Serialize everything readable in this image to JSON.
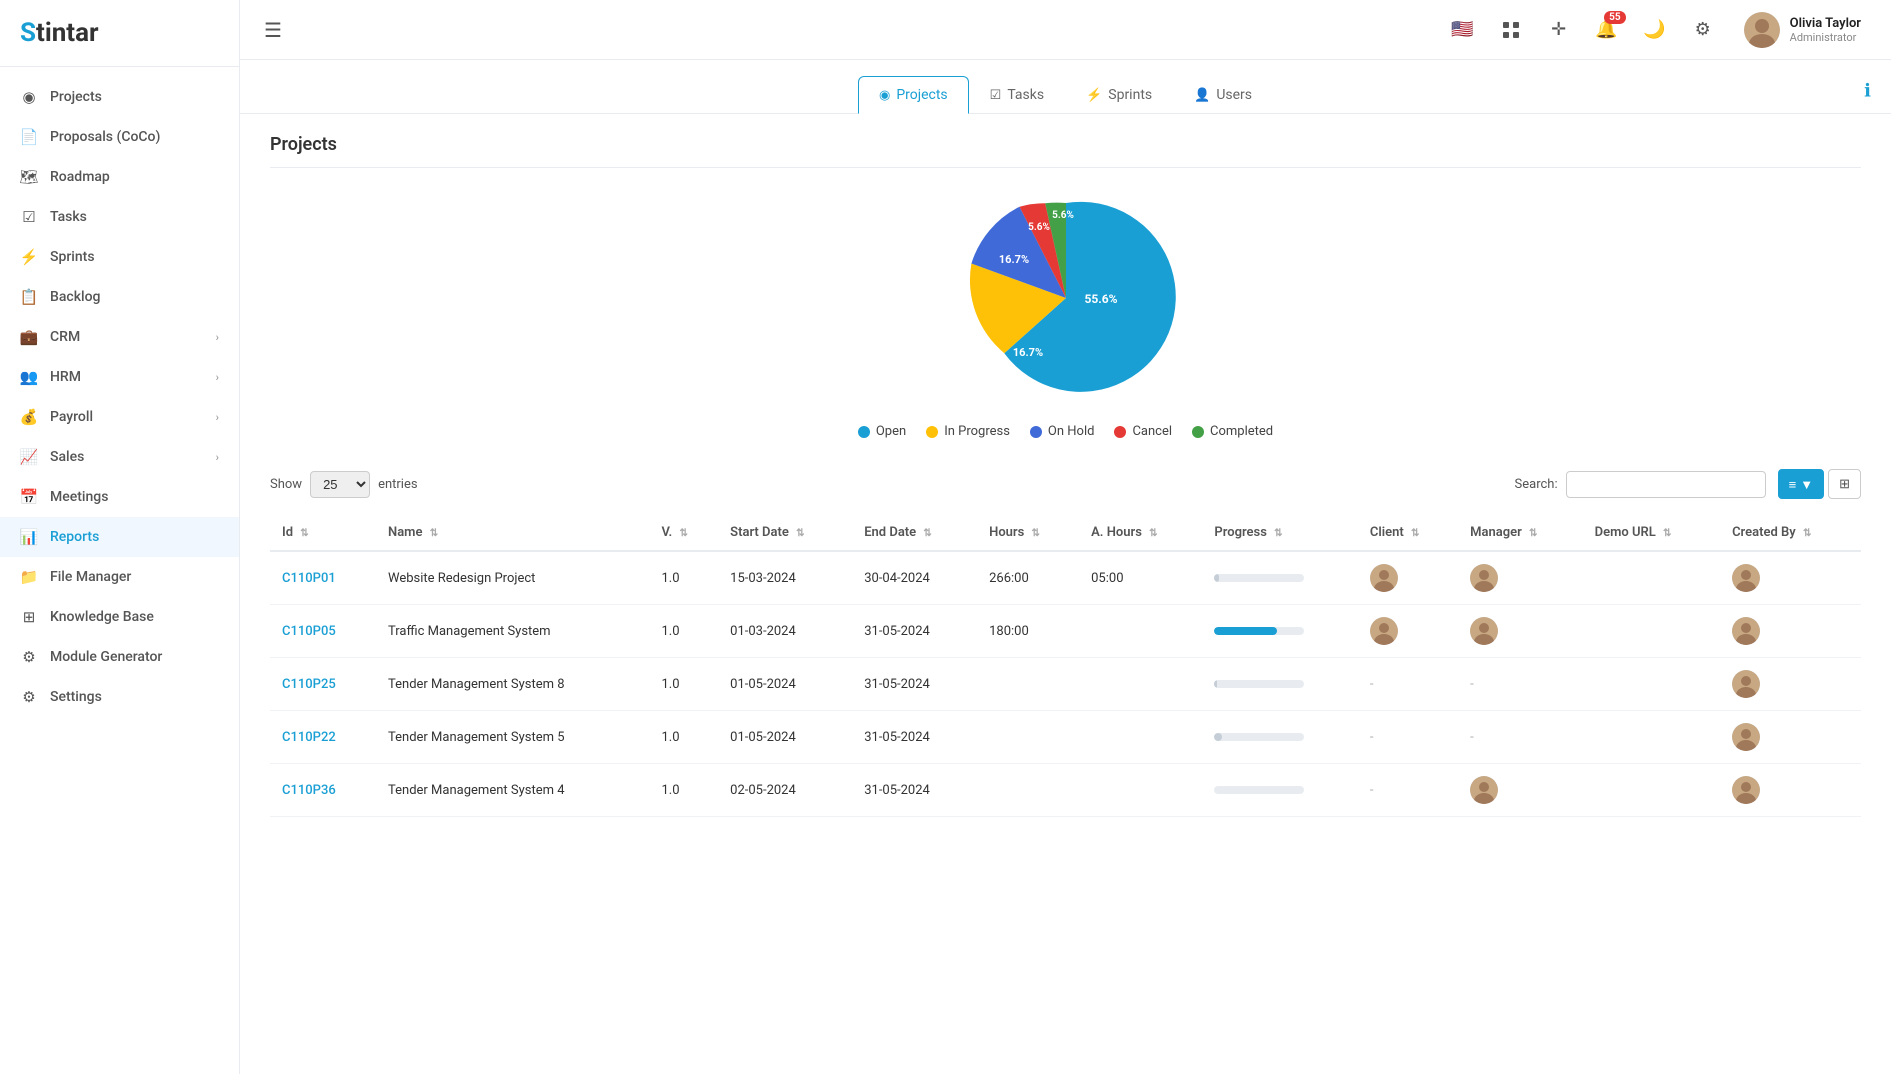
{
  "app": {
    "logo": "Stintar",
    "logo_s": "S"
  },
  "header": {
    "menu_icon": "☰",
    "notification_count": "55",
    "user": {
      "name": "Olivia Taylor",
      "role": "Administrator"
    }
  },
  "sidebar": {
    "items": [
      {
        "id": "projects",
        "label": "Projects",
        "icon": "◉"
      },
      {
        "id": "proposals",
        "label": "Proposals (CoCo)",
        "icon": "📄"
      },
      {
        "id": "roadmap",
        "label": "Roadmap",
        "icon": "🗺"
      },
      {
        "id": "tasks",
        "label": "Tasks",
        "icon": "☑"
      },
      {
        "id": "sprints",
        "label": "Sprints",
        "icon": "⚡"
      },
      {
        "id": "backlog",
        "label": "Backlog",
        "icon": "📋"
      },
      {
        "id": "crm",
        "label": "CRM",
        "icon": "💼",
        "has_children": true
      },
      {
        "id": "hrm",
        "label": "HRM",
        "icon": "👥",
        "has_children": true
      },
      {
        "id": "payroll",
        "label": "Payroll",
        "icon": "💰",
        "has_children": true
      },
      {
        "id": "sales",
        "label": "Sales",
        "icon": "📈",
        "has_children": true
      },
      {
        "id": "meetings",
        "label": "Meetings",
        "icon": "📅"
      },
      {
        "id": "reports",
        "label": "Reports",
        "icon": "📊",
        "active": true
      },
      {
        "id": "filemanager",
        "label": "File Manager",
        "icon": "📁"
      },
      {
        "id": "knowledgebase",
        "label": "Knowledge Base",
        "icon": "⊞"
      },
      {
        "id": "modulegenerator",
        "label": "Module Generator",
        "icon": "⚙"
      },
      {
        "id": "settings",
        "label": "Settings",
        "icon": "⚙"
      }
    ]
  },
  "tabs": [
    {
      "id": "projects",
      "label": "Projects",
      "icon": "◉",
      "active": true
    },
    {
      "id": "tasks",
      "label": "Tasks",
      "icon": "☑"
    },
    {
      "id": "sprints",
      "label": "Sprints",
      "icon": "⚡"
    },
    {
      "id": "users",
      "label": "Users",
      "icon": "👤"
    }
  ],
  "page_title": "Projects",
  "chart": {
    "segments": [
      {
        "label": "Open",
        "value": 55.6,
        "color": "#1a9fd4",
        "text_color": "#fff"
      },
      {
        "label": "In Progress",
        "value": 16.7,
        "color": "#ffc107",
        "text_color": "#fff"
      },
      {
        "label": "On Hold",
        "value": 16.7,
        "color": "#3f6ad8",
        "text_color": "#fff"
      },
      {
        "label": "Cancel",
        "value": 5.6,
        "color": "#e53935",
        "text_color": "#fff"
      },
      {
        "label": "Completed",
        "value": 5.6,
        "color": "#43a047",
        "text_color": "#fff"
      }
    ]
  },
  "table": {
    "show_label": "Show",
    "show_value": "25",
    "entries_label": "entries",
    "search_label": "Search:",
    "search_placeholder": "",
    "columns": [
      {
        "key": "id",
        "label": "Id"
      },
      {
        "key": "name",
        "label": "Name"
      },
      {
        "key": "v",
        "label": "V."
      },
      {
        "key": "start_date",
        "label": "Start Date"
      },
      {
        "key": "end_date",
        "label": "End Date"
      },
      {
        "key": "hours",
        "label": "Hours"
      },
      {
        "key": "a_hours",
        "label": "A. Hours"
      },
      {
        "key": "progress",
        "label": "Progress"
      },
      {
        "key": "client",
        "label": "Client"
      },
      {
        "key": "manager",
        "label": "Manager"
      },
      {
        "key": "demo_url",
        "label": "Demo URL"
      },
      {
        "key": "created_by",
        "label": "Created By"
      }
    ],
    "rows": [
      {
        "id": "C110P01",
        "name": "Website Redesign Project",
        "v": "1.0",
        "start_date": "15-03-2024",
        "end_date": "30-04-2024",
        "hours": "266:00",
        "a_hours": "05:00",
        "progress": 5,
        "has_client": true,
        "has_manager": true,
        "demo_url": "",
        "has_created_by": true
      },
      {
        "id": "C110P05",
        "name": "Traffic Management System",
        "v": "1.0",
        "start_date": "01-03-2024",
        "end_date": "31-05-2024",
        "hours": "180:00",
        "a_hours": "",
        "progress": 70,
        "progress_color": "#1a9fd4",
        "has_client": true,
        "has_manager": true,
        "demo_url": "",
        "has_created_by": true
      },
      {
        "id": "C110P25",
        "name": "Tender Management System 8",
        "v": "1.0",
        "start_date": "01-05-2024",
        "end_date": "31-05-2024",
        "hours": "",
        "a_hours": "",
        "progress": 3,
        "has_client": false,
        "has_manager": false,
        "demo_url": "",
        "has_created_by": true
      },
      {
        "id": "C110P22",
        "name": "Tender Management System 5",
        "v": "1.0",
        "start_date": "01-05-2024",
        "end_date": "31-05-2024",
        "hours": "",
        "a_hours": "",
        "progress": 8,
        "has_client": false,
        "has_manager": false,
        "demo_url": "",
        "has_created_by": true
      },
      {
        "id": "C110P36",
        "name": "Tender Management System 4",
        "v": "1.0",
        "start_date": "02-05-2024",
        "end_date": "31-05-2024",
        "hours": "",
        "a_hours": "",
        "progress": 0,
        "has_client": false,
        "has_manager": true,
        "demo_url": "",
        "has_created_by": true
      }
    ]
  }
}
